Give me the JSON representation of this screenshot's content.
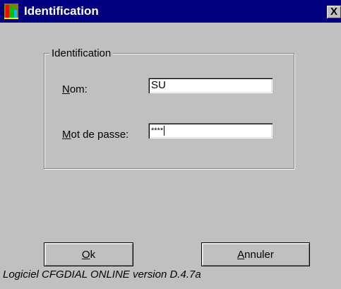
{
  "window": {
    "title": "Identification",
    "close_label": "X"
  },
  "group": {
    "legend": "Identification"
  },
  "form": {
    "nom_label_accel": "N",
    "nom_label_rest": "om:",
    "nom_value": "SU",
    "password_label_accel": "M",
    "password_label_rest": "ot de passe:",
    "password_value": "****"
  },
  "buttons": {
    "ok_accel": "O",
    "ok_rest": "k",
    "cancel_accel": "A",
    "cancel_rest": "nnuler"
  },
  "footer": {
    "text": "Logiciel CFGDIAL ONLINE version D.4.7a"
  },
  "colors": {
    "titlebar": "#020080",
    "face": "#c0c0c0"
  }
}
